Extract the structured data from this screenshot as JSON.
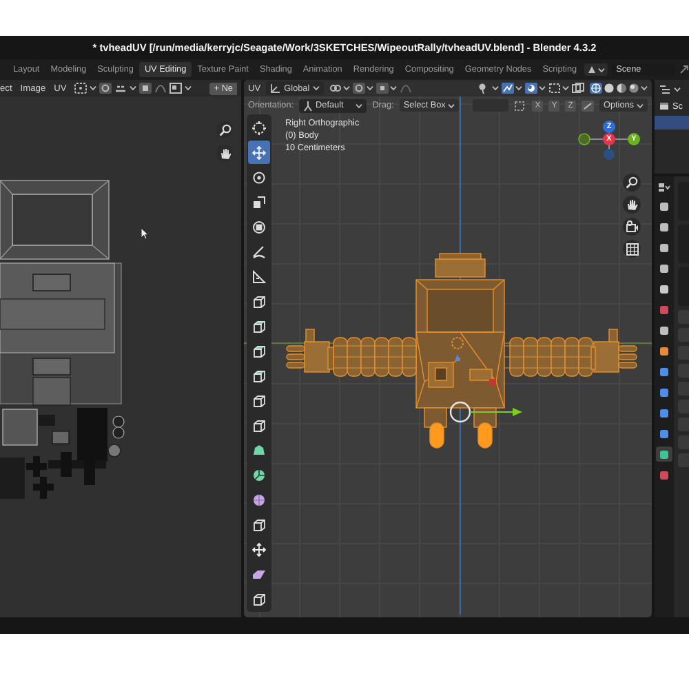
{
  "window": {
    "title": "* tvheadUV [/run/media/kerryjc/Seagate/Work/3SKETCHES/WipeoutRally/tvheadUV.blend] - Blender 4.3.2"
  },
  "workspace_tabs": [
    {
      "label": "Layout",
      "selected": false
    },
    {
      "label": "Modeling",
      "selected": false
    },
    {
      "label": "Sculpting",
      "selected": false
    },
    {
      "label": "UV Editing",
      "selected": true
    },
    {
      "label": "Texture Paint",
      "selected": false
    },
    {
      "label": "Shading",
      "selected": false
    },
    {
      "label": "Animation",
      "selected": false
    },
    {
      "label": "Rendering",
      "selected": false
    },
    {
      "label": "Compositing",
      "selected": false
    },
    {
      "label": "Geometry Nodes",
      "selected": false
    },
    {
      "label": "Scripting",
      "selected": false
    }
  ],
  "scene": {
    "label": "Scene"
  },
  "uv_editor": {
    "menus": [
      "ect",
      "Image",
      "UV"
    ],
    "new_button": "+ Ne"
  },
  "viewport": {
    "mode": "UV",
    "transform_orientation": "Global",
    "orientation_label": "Orientation:",
    "orientation_value": "Default",
    "drag_label": "Drag:",
    "drag_value": "Select Box",
    "axes": [
      "X",
      "Y",
      "Z"
    ],
    "options": "Options",
    "overlay_lines": [
      "Right Orthographic",
      "(0) Body",
      "10 Centimeters"
    ],
    "gizmo_axes": [
      {
        "label": "Z",
        "color": "#2f6ed6"
      },
      {
        "label": "X",
        "color": "#e8334f"
      },
      {
        "label": "Y",
        "color": "#6cb11f"
      }
    ],
    "tools": [
      {
        "kind": "cursor",
        "selected": false
      },
      {
        "kind": "move",
        "selected": true
      },
      {
        "kind": "rotate",
        "selected": false
      },
      {
        "kind": "scale",
        "selected": false
      },
      {
        "kind": "transform",
        "selected": false
      },
      {
        "kind": "pen",
        "selected": false
      },
      {
        "kind": "ruler",
        "selected": false
      },
      {
        "kind": "cube",
        "selected": false
      },
      {
        "kind": "green-cube",
        "selected": false
      },
      {
        "kind": "green-cube",
        "selected": false
      },
      {
        "kind": "green-cube",
        "selected": false
      },
      {
        "kind": "cube",
        "selected": false
      },
      {
        "kind": "cube",
        "selected": false
      },
      {
        "kind": "blob",
        "selected": false
      },
      {
        "kind": "spin",
        "selected": false
      },
      {
        "kind": "sphere",
        "selected": false
      },
      {
        "kind": "cube",
        "selected": false
      },
      {
        "kind": "move",
        "selected": false
      },
      {
        "kind": "slab",
        "selected": false
      },
      {
        "kind": "cube",
        "selected": false
      }
    ]
  },
  "outliner": {
    "label": "Sc"
  },
  "property_tabs": [
    {
      "color": "#bdbdbd",
      "selected": false
    },
    {
      "color": "#bdbdbd",
      "selected": false
    },
    {
      "color": "#bdbdbd",
      "selected": false
    },
    {
      "color": "#bdbdbd",
      "selected": false
    },
    {
      "color": "#c9c9c9",
      "selected": false
    },
    {
      "color": "#d14a5b",
      "selected": false
    },
    {
      "color": "#bdbdbd",
      "selected": false
    },
    {
      "color": "#e5893a",
      "selected": false
    },
    {
      "color": "#4f8ee8",
      "selected": false
    },
    {
      "color": "#4f8ee8",
      "selected": false
    },
    {
      "color": "#4f8ee8",
      "selected": false
    },
    {
      "color": "#4f8ee8",
      "selected": false
    },
    {
      "color": "#3fc48f",
      "selected": true
    },
    {
      "color": "#d14a5b",
      "selected": false
    }
  ]
}
